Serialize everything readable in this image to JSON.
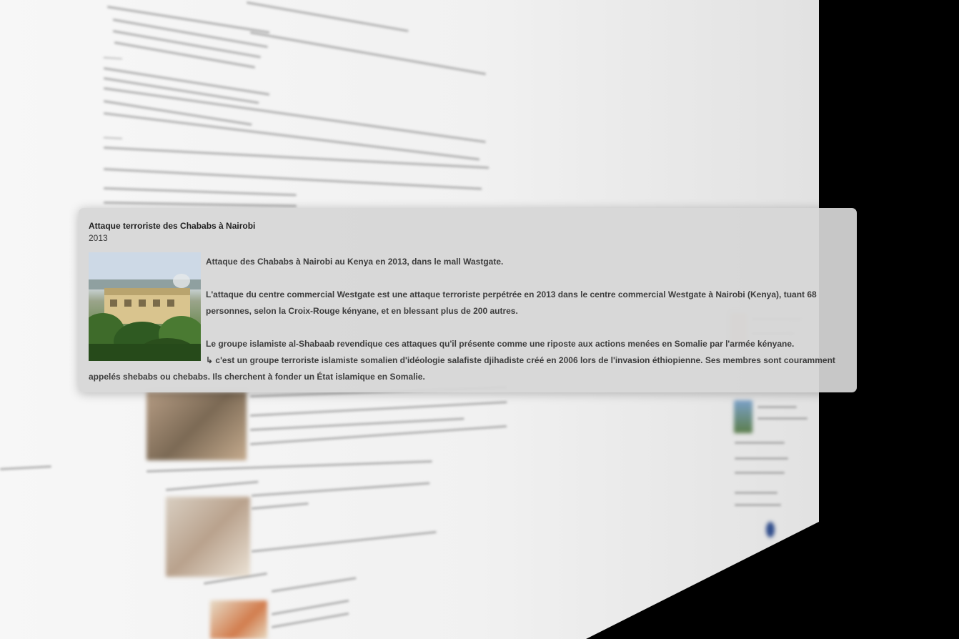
{
  "popup": {
    "title": "Attaque terroriste des Chababs à Nairobi",
    "year": "2013",
    "image_icon": "mall-photo",
    "paragraphs": [
      "Attaque des Chababs à Nairobi au Kenya en 2013, dans le mall Wastgate.",
      "L'attaque du centre commercial Westgate est une attaque terroriste perpétrée en 2013 dans le centre commercial Westgate à Nairobi (Kenya), tuant 68 personnes, selon la Croix-Rouge kényane, et en blessant plus de 200 autres.",
      "Le groupe islamiste al-Shabaab revendique ces attaques qu'il présente comme une riposte aux actions menées en Somalie par l'armée kényane.",
      "↳ c'est un groupe terroriste islamiste somalien d'idéologie salafiste djihadiste créé en 2006 lors de l'invasion éthiopienne. Ses membres sont couramment appelés shebabs  ou chebabs. Ils cherchent à fonder un État islamique en Somalie."
    ]
  },
  "colors": {
    "popup_bg": "#d6d6d6",
    "page_bg": "#f2f2f2",
    "outer_bg": "#000000"
  }
}
